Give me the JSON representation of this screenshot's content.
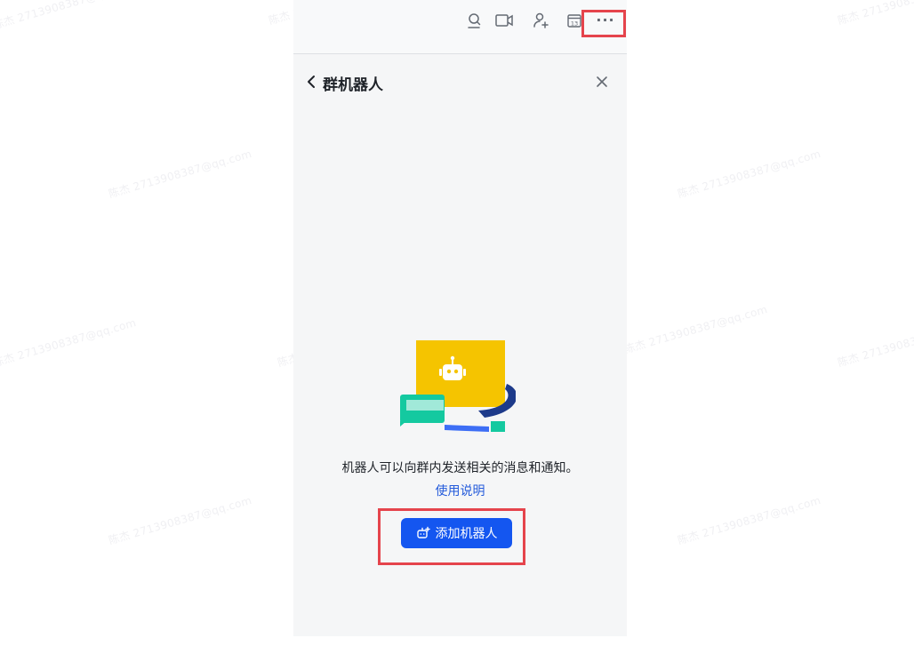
{
  "watermark": "陈杰 2713908387@qq.com",
  "topbar": {
    "icons": [
      "search-person-icon",
      "video-icon",
      "add-member-icon",
      "calendar-icon",
      "more-icon"
    ],
    "calendar_day": "13",
    "more_label": "···"
  },
  "header": {
    "title": "群机器人"
  },
  "empty_state": {
    "description": "机器人可以向群内发送相关的消息和通知。",
    "help_link": "使用说明",
    "add_button_label": "添加机器人"
  },
  "colors": {
    "accent": "#1456f0",
    "link": "#245bdb",
    "highlight": "#e5444c",
    "illus_yellow": "#f5c400",
    "illus_teal": "#14c9a0",
    "illus_navy": "#1d3a8a"
  }
}
